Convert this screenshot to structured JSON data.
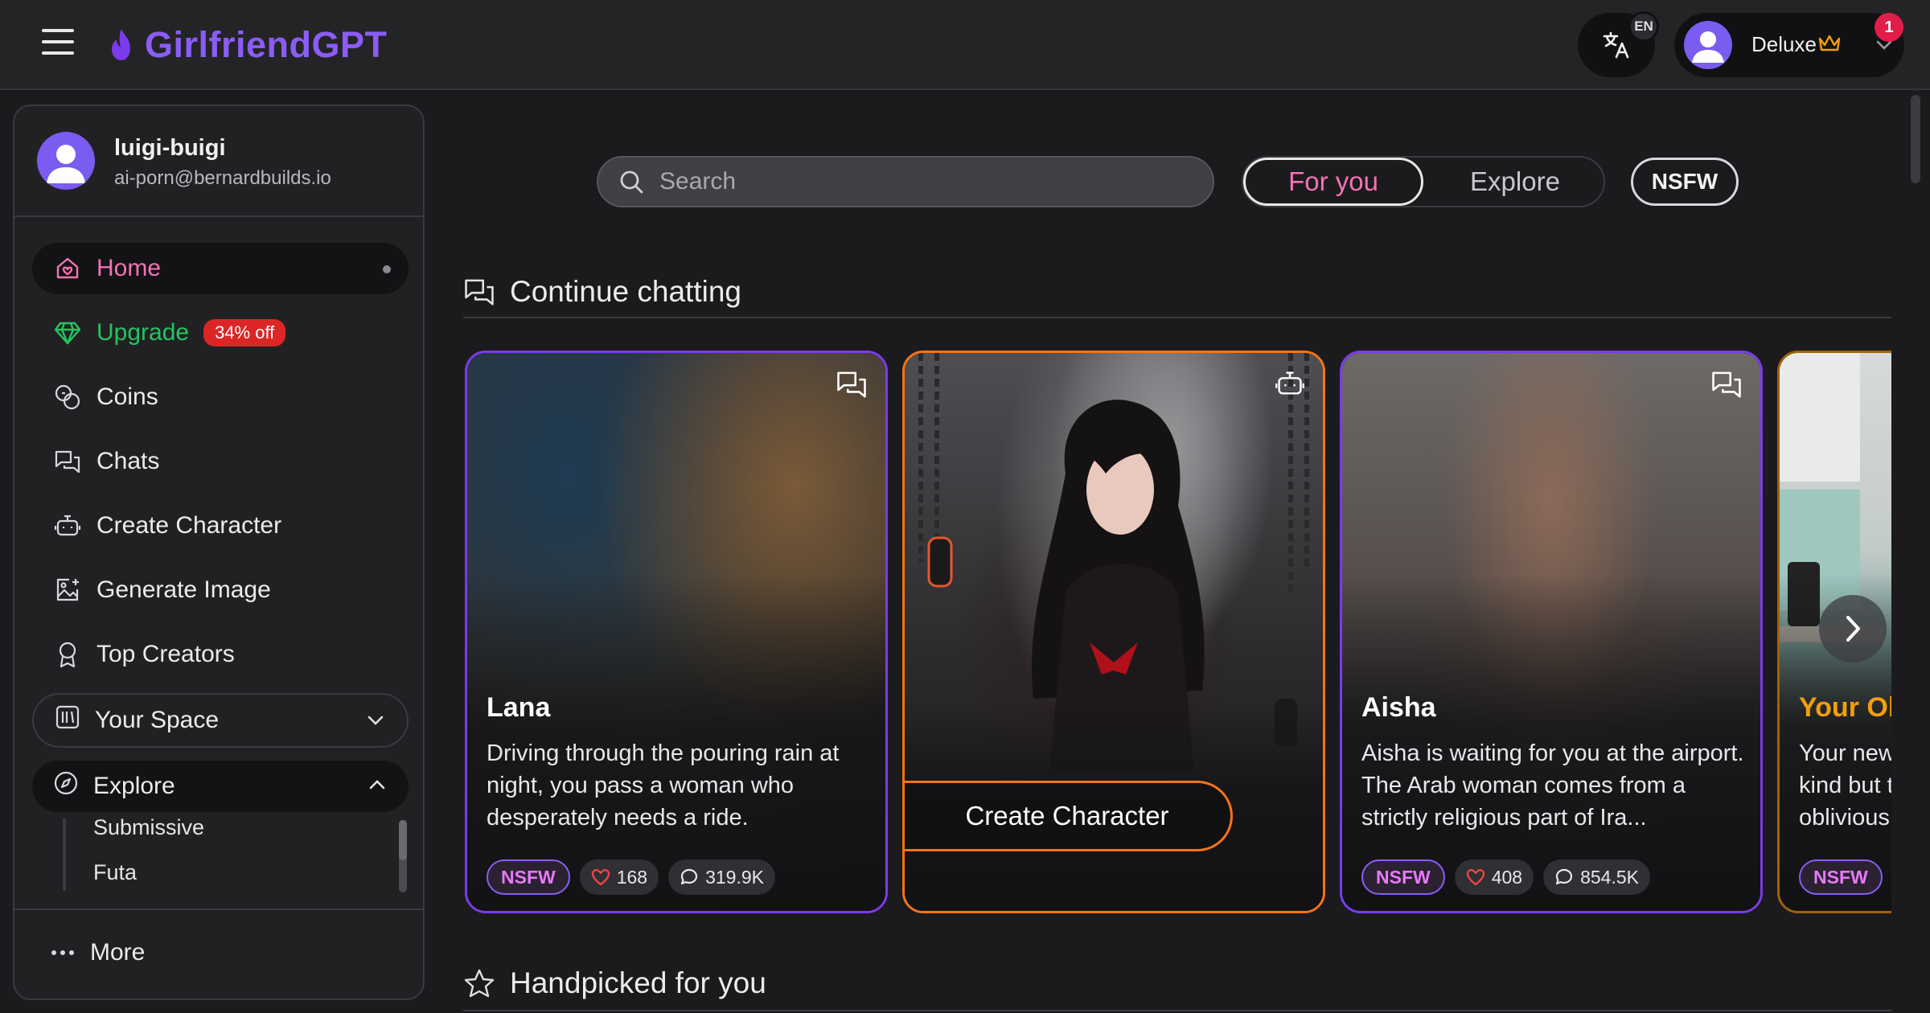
{
  "brand": {
    "name": "GirlfriendGPT"
  },
  "header": {
    "language_badge": "EN",
    "account_label": "Deluxe",
    "notification_count": "1"
  },
  "sidebar": {
    "user_name": "luigi-buigi",
    "user_email": "ai-porn@bernardbuilds.io",
    "items": [
      {
        "label": "Home",
        "icon": "home-icon"
      },
      {
        "label": "Upgrade",
        "icon": "gem-icon",
        "badge": "34% off"
      },
      {
        "label": "Coins",
        "icon": "coins-icon"
      },
      {
        "label": "Chats",
        "icon": "chats-icon"
      },
      {
        "label": "Create Character",
        "icon": "robot-icon"
      },
      {
        "label": "Generate Image",
        "icon": "image-plus-icon"
      },
      {
        "label": "Top Creators",
        "icon": "award-icon"
      }
    ],
    "your_space": "Your Space",
    "explore": "Explore",
    "explore_subitems": [
      "Submissive",
      "Futa"
    ],
    "more": "More"
  },
  "search": {
    "placeholder": "Search"
  },
  "tabs": {
    "for_you": "For you",
    "explore": "Explore",
    "nsfw": "NSFW"
  },
  "sections": {
    "continue_chatting": "Continue chatting",
    "handpicked": "Handpicked for you"
  },
  "cards": [
    {
      "name": "Lana",
      "desc": "Driving through the pouring rain at night, you pass a woman who desperately needs a ride.",
      "tag": "NSFW",
      "likes": "168",
      "chats": "319.9K"
    },
    {
      "button": "Create Character"
    },
    {
      "name": "Aisha",
      "desc": "Aisha is waiting for you at the airport. The Arab woman comes from a strictly religious part of Ira...",
      "tag": "NSFW",
      "likes": "408",
      "chats": "854.5K"
    },
    {
      "name": "Your Ob",
      "desc": "Your new kind but t oblivious",
      "tag": "NSFW"
    }
  ],
  "colors": {
    "accent_pink": "#f472b6",
    "accent_purple": "#8b5cf6",
    "upgrade_green": "#22c55e",
    "create_orange": "#f97316"
  }
}
